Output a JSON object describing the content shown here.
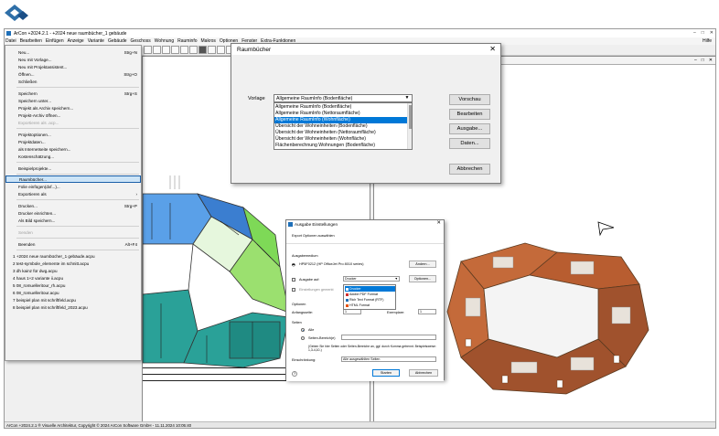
{
  "app": {
    "title": "ArCon +2024.2.1 - +2024 neue raumbücher_1 gebäude",
    "window_controls": [
      "–",
      "□",
      "✕"
    ]
  },
  "menubar": {
    "items": [
      "Datei",
      "Bearbeiten",
      "Einfügen",
      "Anzeige",
      "Variante",
      "Gebäude",
      "Geschoss",
      "Wohnung",
      "Rauminfo",
      "Makros",
      "Optionen",
      "Fenster",
      "Extra-Funktionen"
    ],
    "help": "Hilfe"
  },
  "toolbar": {
    "wabe_combo": "Wabe 1",
    "geschoss_combo": "Erdgeschoss"
  },
  "file_menu": {
    "items": [
      {
        "label": "Neu...",
        "shortcut": "Strg+N"
      },
      {
        "label": "Neu mit Vorlage...",
        "shortcut": ""
      },
      {
        "label": "Neu mit Projektassistent...",
        "shortcut": ""
      },
      {
        "label": "Öffnen...",
        "shortcut": "Strg+O"
      },
      {
        "label": "Schließen",
        "shortcut": ""
      },
      {
        "label": "Speichern",
        "shortcut": "Strg+S"
      },
      {
        "label": "Speichern unter...",
        "shortcut": ""
      },
      {
        "label": "Projekt als Archiv speichern...",
        "shortcut": ""
      },
      {
        "label": "Projekt-Archiv öffnen...",
        "shortcut": ""
      },
      {
        "label": "Exportieren als .acp...",
        "shortcut": "",
        "disabled": true
      },
      {
        "label": "Projektoptionen...",
        "shortcut": ""
      },
      {
        "label": "Projektdaten...",
        "shortcut": ""
      },
      {
        "label": "als Internetseite speichern...",
        "shortcut": ""
      },
      {
        "label": "Kostenschätzung...",
        "shortcut": ""
      },
      {
        "label": "Beispielprojekte...",
        "shortcut": ""
      },
      {
        "label": "Raumbücher...",
        "shortcut": "",
        "highlighted": true
      },
      {
        "label": "Folie einfügen(dxf...)...",
        "shortcut": ""
      },
      {
        "label": "Exportieren als",
        "shortcut": "›"
      },
      {
        "label": "Drucken...",
        "shortcut": "Strg+P"
      },
      {
        "label": "Drucker einrichten...",
        "shortcut": ""
      },
      {
        "label": "Als Bild speichern...",
        "shortcut": ""
      },
      {
        "label": "Senden",
        "shortcut": "",
        "disabled": true
      },
      {
        "label": "Beenden",
        "shortcut": "Alt+F4"
      }
    ],
    "recent": [
      "1 +2024 neue raumbücher_1 gebäude.acpu",
      "2 test-symbole_elemente im schnitt.acpu",
      "3 dh kainz für dwg.acpu",
      "4 haus 1+2 variante ii.acpu",
      "5 08_romuelleritour_rh.acpu",
      "6 08_romuelleritour.acpu",
      "7 beispiel plan mit schriftfeld.acpu",
      "8 beispiel plan mit schriftfeld_2023.acpu"
    ]
  },
  "views": {
    "right_title": "Wabe 1 Erdgeschoss, aktuelle Kolonierung: Standard"
  },
  "raumbuecher_dialog": {
    "title": "Raumbücher",
    "close": "✕",
    "vorlage_label": "Vorlage",
    "selected_value": "Allgemeine RaumInfo (Bodenfläche)",
    "list": [
      "Allgemeine RaumInfo (Bodenfläche)",
      "Allgemeine RaumInfo (Nettoraumfläche)",
      "Allgemeine RaumInfo (Wohnfläche)",
      "Übersicht der Wohneinheiten (Bodenfläche)",
      "Übersicht der Wohneinheiten (Nettoraumfläche)",
      "Übersicht der Wohneinheiten (Wohnfläche)",
      "Flächenberechnung Wohnungen (Bodenfläche)"
    ],
    "selected_index": 2,
    "buttons": [
      "Vorschau",
      "Bearbeiten",
      "Ausgabe...",
      "Daten...",
      "Abbrechen"
    ]
  },
  "ausgabe_dialog": {
    "title": "Ausgabe Einstellungen",
    "close": "✕",
    "subtitle": "Export Optionen auswählen",
    "ausgabemedium_label": "Ausgabemedium",
    "printer_name": "HP5F0212 (HP OfficeJet Pro 8010 series)",
    "aendern_button": "Ändern...",
    "ausgabe_auf_label": "Ausgabe auf:",
    "ausgabe_auf_value": "Drucker",
    "optionen_button": "Optionen...",
    "einstellungen_label": "Einstellungen gemerkt",
    "dropdown_options": [
      "Drucker",
      "Adobe PDF Format",
      "Rich Text Format (RTF)",
      "HTML Format"
    ],
    "dropdown_selected": 0,
    "optionen_label": "Optionen",
    "anfangsseite_label": "Anfangsseite:",
    "anfangsseite_value": "1",
    "exemplare_label": "Exemplare:",
    "exemplare_value": "1",
    "seiten_label": "Seiten",
    "alle_label": "Alle",
    "bereich_label": "Seiten-Bereich(e)",
    "bereich_hint": "(Geben Sie hier Seiten oder Seiten-Bereiche an, ggf. durch Komma getrennt. Beispielsweise: 1,3-4,10-)",
    "einschraenkung_label": "Einschränkung:",
    "einschraenkung_value": "Alle ausgewählten Seiten",
    "help_icon": "?",
    "starten_button": "Starten",
    "abbrechen_button": "Abbrechen"
  },
  "statusbar": {
    "text": "ArCon +2024.2.1 ® Visuelle Architektur, Copyright © 2024 ArCon Software GmbH - 11.11.2024 10:05:40"
  },
  "colors": {
    "accent_blue": "#0078d7",
    "plan_green": "#7ed957",
    "plan_teal": "#2aa198",
    "plan_blue": "#2979ff",
    "model_brown": "#a0522d"
  }
}
